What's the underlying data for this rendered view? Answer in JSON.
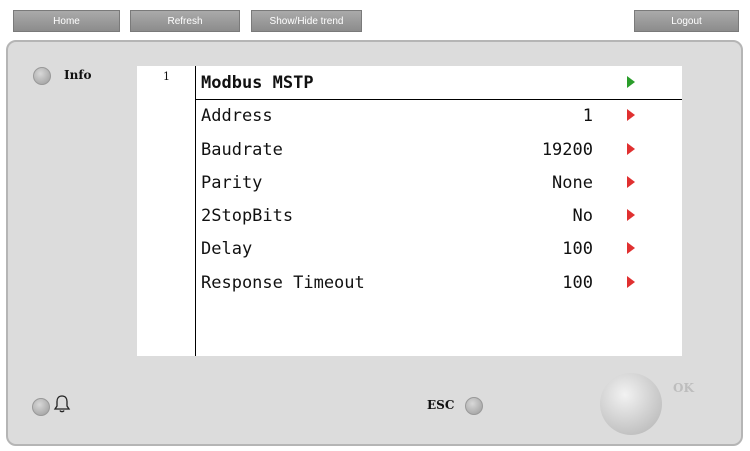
{
  "toolbar": {
    "home_label": "Home",
    "refresh_label": "Refresh",
    "trend_label": "Show/Hide trend",
    "logout_label": "Logout"
  },
  "panel": {
    "info_label": "Info",
    "esc_label": "ESC",
    "ok_label": "OK"
  },
  "screen": {
    "page_number": "1",
    "title": "Modbus MSTP",
    "rows": [
      {
        "name": "Address",
        "value": "1"
      },
      {
        "name": "Baudrate",
        "value": "19200"
      },
      {
        "name": "Parity",
        "value": "None"
      },
      {
        "name": "2StopBits",
        "value": "No"
      },
      {
        "name": "Delay",
        "value": "100"
      },
      {
        "name": "Response Timeout",
        "value": "100"
      }
    ]
  },
  "colors": {
    "title_arrow": "#2a9d2a",
    "row_arrow": "#e03030",
    "panel_bg": "#dcdcdc"
  },
  "icons": {
    "alarm": "bell-icon",
    "forward": "play-arrow-icon"
  }
}
